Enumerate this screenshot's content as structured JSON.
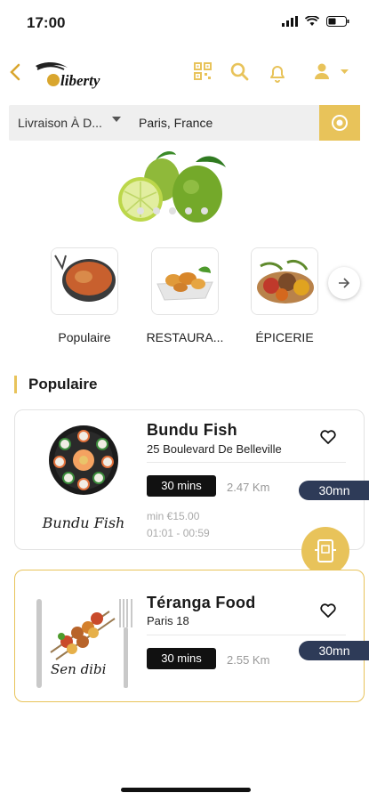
{
  "status": {
    "time": "17:00"
  },
  "header": {
    "logo": "liberty"
  },
  "search": {
    "mode": "Livraison À D...",
    "city": "Paris, France"
  },
  "categories": [
    {
      "label": "Populaire"
    },
    {
      "label": "RESTAURA..."
    },
    {
      "label": "ÉPICERIE"
    }
  ],
  "section": {
    "title": "Populaire"
  },
  "restaurants": [
    {
      "name": "Bundu Fish",
      "address": "25 Boulevard De Belleville",
      "time": "30 mins",
      "distance": "2.47 Km",
      "badge": "30mn",
      "min_order": "min €15.00",
      "hours": "01:01 - 00:59",
      "image_caption": "Bundu Fish"
    },
    {
      "name": "Téranga Food",
      "address": "Paris 18",
      "time": "30 mins",
      "distance": "2.55 Km",
      "badge": "30mn",
      "image_caption": "Sen dibi"
    }
  ],
  "colors": {
    "accent": "#e8c35a",
    "badge": "#2e3b58"
  }
}
